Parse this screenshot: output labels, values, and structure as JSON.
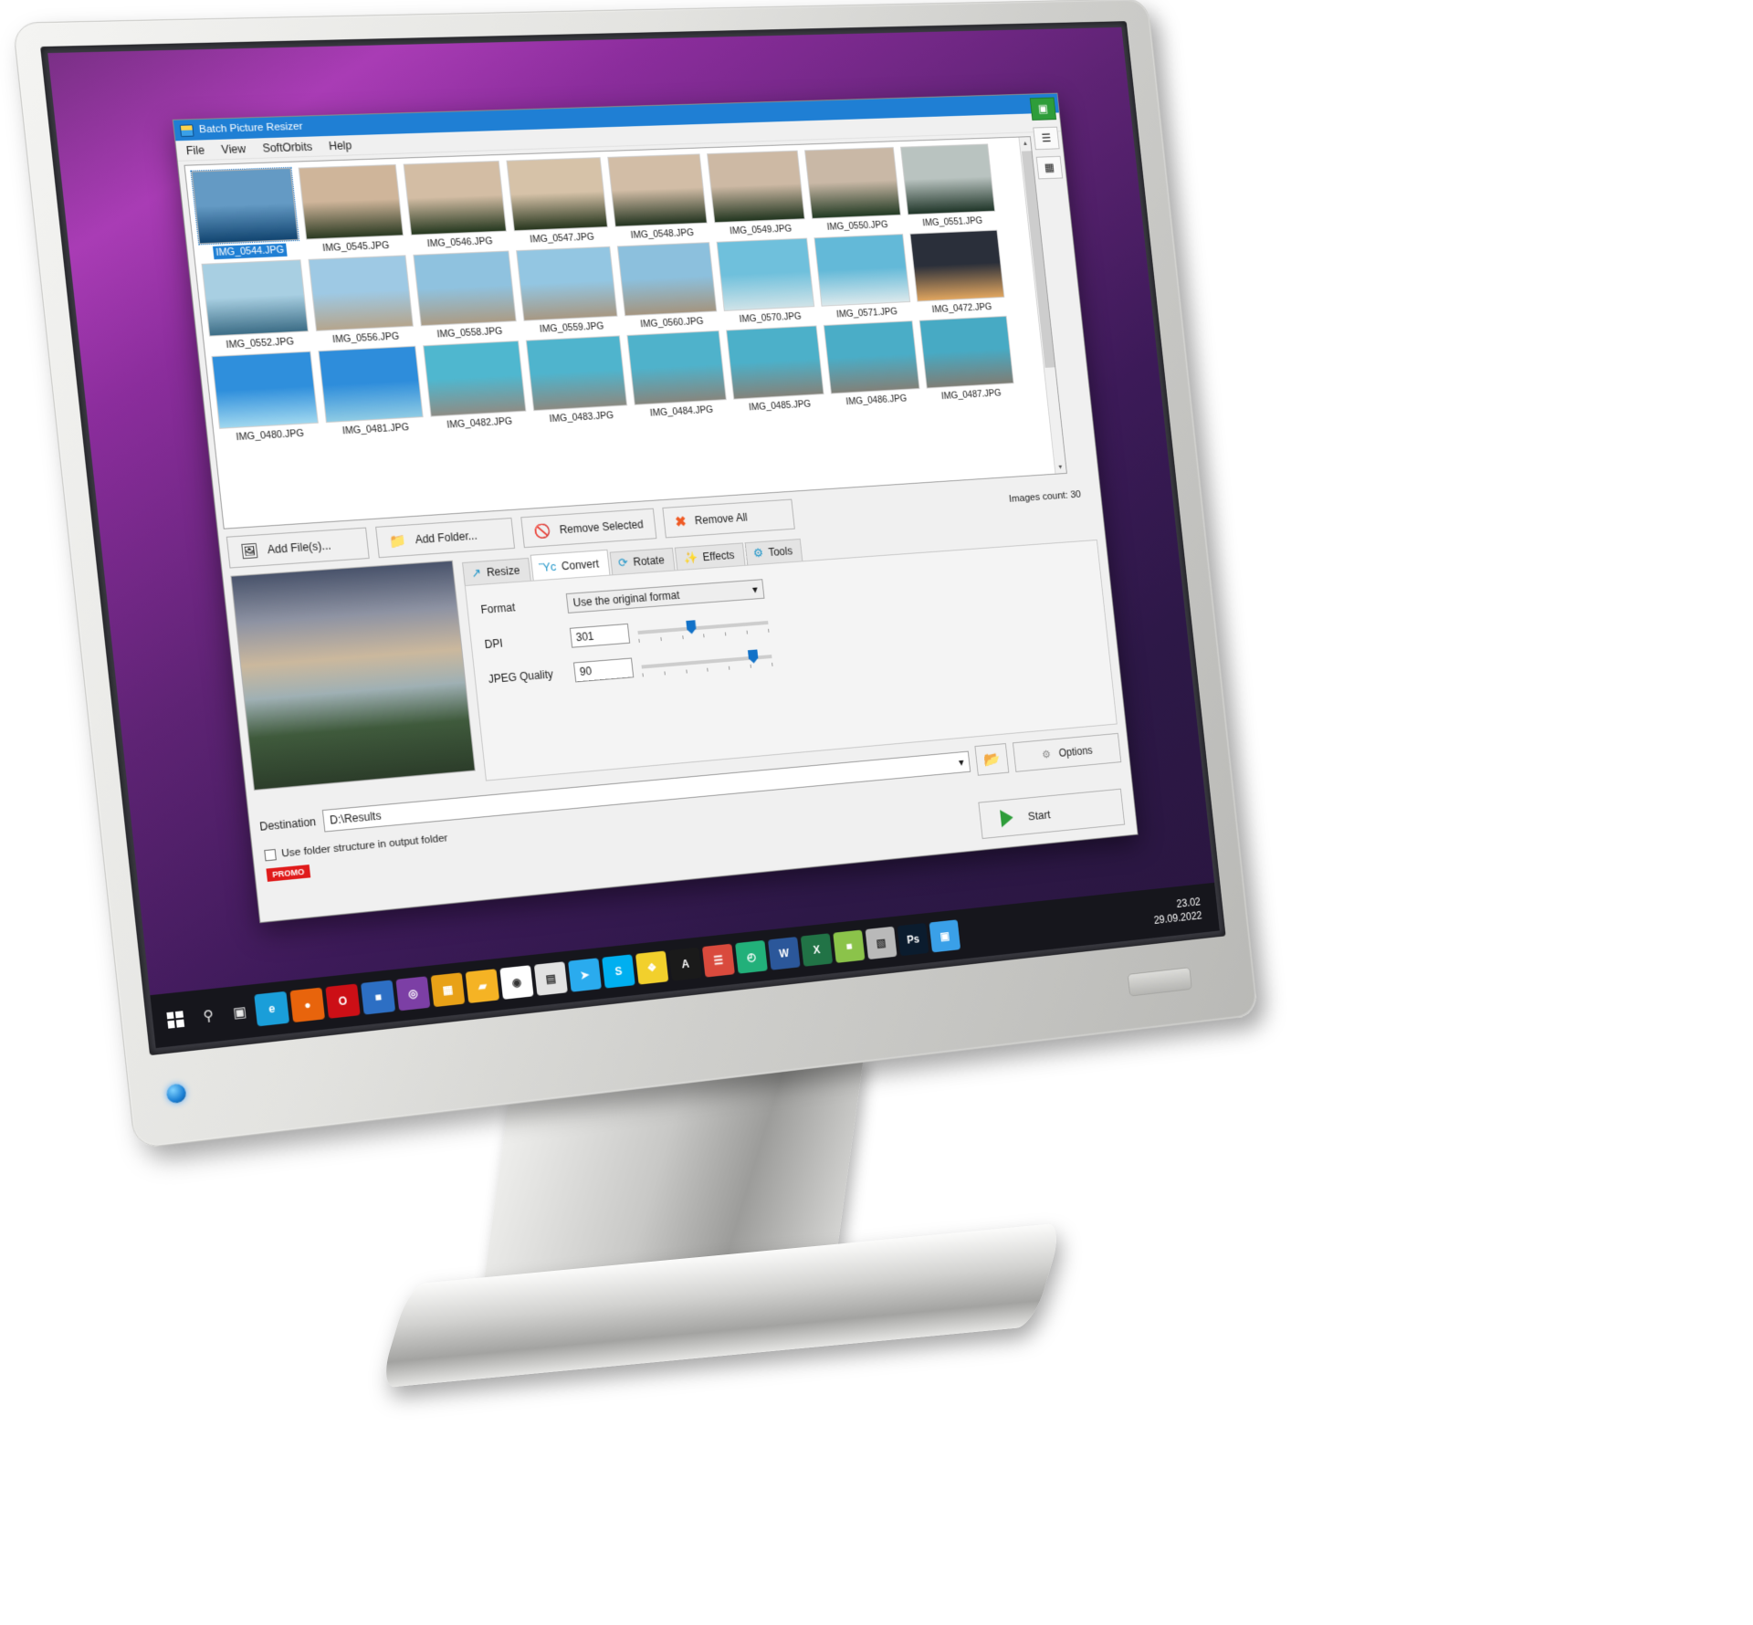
{
  "window": {
    "title": "Batch Picture Resizer",
    "title_icon": "app-icon",
    "minimize": "–",
    "maximize": "❐",
    "close": "✕"
  },
  "menubar": [
    "File",
    "View",
    "SoftOrbits",
    "Help"
  ],
  "thumbnails": {
    "rows": [
      [
        {
          "name": "IMG_0544.JPG",
          "selected": true,
          "c1": "#7fb4dd",
          "c2": "#1d4f7a"
        },
        {
          "name": "IMG_0545.JPG",
          "selected": false,
          "c1": "#cfb59a",
          "c2": "#2b3a22"
        },
        {
          "name": "IMG_0546.JPG",
          "selected": false,
          "c1": "#d3bda4",
          "c2": "#25381f"
        },
        {
          "name": "IMG_0547.JPG",
          "selected": false,
          "c1": "#d6c2a8",
          "c2": "#27361e"
        },
        {
          "name": "IMG_0548.JPG",
          "selected": false,
          "c1": "#d2bda6",
          "c2": "#233420"
        },
        {
          "name": "IMG_0549.JPG",
          "selected": false,
          "c1": "#cdb9a4",
          "c2": "#21351f"
        },
        {
          "name": "IMG_0550.JPG",
          "selected": false,
          "c1": "#c9b8a6",
          "c2": "#223a23"
        },
        {
          "name": "IMG_0551.JPG",
          "selected": false,
          "c1": "#b9c3c0",
          "c2": "#1f3528"
        }
      ],
      [
        {
          "name": "IMG_0552.JPG",
          "selected": false,
          "c1": "#a8cfe2",
          "c2": "#3c6d86"
        },
        {
          "name": "IMG_0556.JPG",
          "selected": false,
          "c1": "#9ec9e4",
          "c2": "#b5a58d"
        },
        {
          "name": "IMG_0558.JPG",
          "selected": false,
          "c1": "#8fc2df",
          "c2": "#ab9c86"
        },
        {
          "name": "IMG_0559.JPG",
          "selected": false,
          "c1": "#93c6e2",
          "c2": "#a79883"
        },
        {
          "name": "IMG_0560.JPG",
          "selected": false,
          "c1": "#8cc0dd",
          "c2": "#a49580"
        },
        {
          "name": "IMG_0570.JPG",
          "selected": false,
          "c1": "#6fc0dc",
          "c2": "#cfe3e8"
        },
        {
          "name": "IMG_0571.JPG",
          "selected": false,
          "c1": "#63b9d8",
          "c2": "#dbe9ec"
        },
        {
          "name": "IMG_0472.JPG",
          "selected": false,
          "c1": "#2a2f3a",
          "c2": "#e0a55f"
        }
      ],
      [
        {
          "name": "IMG_0480.JPG",
          "selected": false,
          "c1": "#2f8fdc",
          "c2": "#9fd7ef"
        },
        {
          "name": "IMG_0481.JPG",
          "selected": false,
          "c1": "#2e8ddb",
          "c2": "#8ecbe4"
        },
        {
          "name": "IMG_0482.JPG",
          "selected": false,
          "c1": "#4fb7cf",
          "c2": "#8d8d86"
        },
        {
          "name": "IMG_0483.JPG",
          "selected": false,
          "c1": "#4fb4cd",
          "c2": "#8a8a82"
        },
        {
          "name": "IMG_0484.JPG",
          "selected": false,
          "c1": "#4fb2cb",
          "c2": "#86867e"
        },
        {
          "name": "IMG_0485.JPG",
          "selected": false,
          "c1": "#4cb0c9",
          "c2": "#83837b"
        },
        {
          "name": "IMG_0486.JPG",
          "selected": false,
          "c1": "#4aadc7",
          "c2": "#818179"
        },
        {
          "name": "IMG_0487.JPG",
          "selected": false,
          "c1": "#47aac4",
          "c2": "#7e7e76"
        }
      ]
    ]
  },
  "sidetools": [
    {
      "name": "thumbnail-view",
      "glyph": "▣"
    },
    {
      "name": "list-view",
      "glyph": "☰"
    },
    {
      "name": "details-view",
      "glyph": "▦"
    }
  ],
  "toolbar": {
    "add_files": "Add File(s)...",
    "add_folder": "Add Folder...",
    "remove_selected": "Remove Selected",
    "remove_all": "Remove All",
    "images_count": "Images count: 30",
    "icons": {
      "add_files": "picture-icon",
      "add_folder": "folder-icon",
      "remove_selected": "forbidden-icon",
      "remove_all": "x-mark-icon"
    }
  },
  "tabs": [
    {
      "label": "Resize",
      "icon": "resize-arrow-icon",
      "glyph": "↗",
      "active": false
    },
    {
      "label": "Convert",
      "icon": "convert-picture-icon",
      "glyph": "Ὓc",
      "active": true
    },
    {
      "label": "Rotate",
      "icon": "rotate-icon",
      "glyph": "⟳",
      "active": false
    },
    {
      "label": "Effects",
      "icon": "magic-wand-icon",
      "glyph": "✨",
      "active": false
    },
    {
      "label": "Tools",
      "icon": "gear-icon",
      "glyph": "⚙",
      "active": false
    }
  ],
  "convert_panel": {
    "format_label": "Format",
    "format_value": "Use the original format",
    "dpi_label": "DPI",
    "dpi_value": "301",
    "dpi_slider_pct": 37,
    "jpeg_label": "JPEG Quality",
    "jpeg_value": "90",
    "jpeg_slider_pct": 82
  },
  "footer": {
    "destination_label": "Destination",
    "destination_value": "D:\\Results",
    "browse_icon": "open-folder-icon",
    "options_label": "Options",
    "options_icon": "gear-icon",
    "checkbox_label": "Use folder structure in output folder",
    "checkbox_checked": false,
    "promo_label": "PROMO",
    "start_label": "Start",
    "start_icon": "green-arrow-icon"
  },
  "taskbar": {
    "start_icon": "windows-logo-icon",
    "search_icon": "search-icon",
    "taskview_icon": "task-view-icon",
    "apps": [
      {
        "name": "edge",
        "glyph": "e",
        "bg": "#1a9ed9"
      },
      {
        "name": "firefox",
        "glyph": "●",
        "bg": "#e8640c"
      },
      {
        "name": "opera",
        "glyph": "O",
        "bg": "#cc0f16"
      },
      {
        "name": "explorer-blue",
        "glyph": "■",
        "bg": "#2d6fc4"
      },
      {
        "name": "vlc-purple",
        "glyph": "◎",
        "bg": "#7c3fa5"
      },
      {
        "name": "notes",
        "glyph": "▦",
        "bg": "#e8a117"
      },
      {
        "name": "file-explorer",
        "glyph": "▰",
        "bg": "#f5b324"
      },
      {
        "name": "chrome",
        "glyph": "◉",
        "bg": "#ffffff"
      },
      {
        "name": "store",
        "glyph": "▤",
        "bg": "#e2e2e2"
      },
      {
        "name": "telegram",
        "glyph": "➤",
        "bg": "#2aabee"
      },
      {
        "name": "skype",
        "glyph": "S",
        "bg": "#00aff0"
      },
      {
        "name": "photo-editor",
        "glyph": "❖",
        "bg": "#f2d02c"
      },
      {
        "name": "adobe",
        "glyph": "A",
        "bg": "#1a1a1a"
      },
      {
        "name": "reader",
        "glyph": "☰",
        "bg": "#d94a3d"
      },
      {
        "name": "timer",
        "glyph": "◴",
        "bg": "#22b07a"
      },
      {
        "name": "word",
        "glyph": "W",
        "bg": "#2b579a"
      },
      {
        "name": "excel",
        "glyph": "X",
        "bg": "#217346"
      },
      {
        "name": "paint",
        "glyph": "■",
        "bg": "#8bc34a"
      },
      {
        "name": "archiver",
        "glyph": "▧",
        "bg": "#b9b9b9"
      },
      {
        "name": "photoshop",
        "glyph": "Ps",
        "bg": "#0b1c2e"
      },
      {
        "name": "batch-resizer",
        "glyph": "▣",
        "bg": "#3aa0e8"
      }
    ],
    "time": "23.02",
    "date": "29.09.2022"
  }
}
